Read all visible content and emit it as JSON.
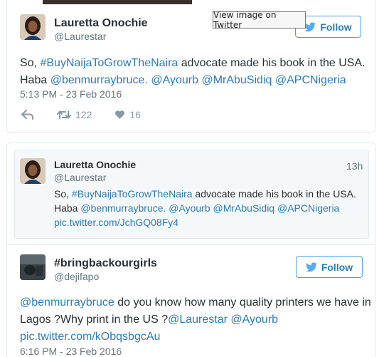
{
  "tooltip": "View image on Twitter",
  "tweet1": {
    "name": "Lauretta Onochie",
    "handle": "@Laurestar",
    "follow_label": "Follow",
    "text_line1_prefix": "So, ",
    "text_line1_hashtag": "#BuyNaijaToGrowTheNaira",
    "text_line1_suffix": " advocate made his book in the USA.",
    "text_line2_prefix": "Haba ",
    "mention1": "@benmurraybruce.",
    "mention2": "@Ayourb",
    "mention3": "@MrAbuSidiq",
    "mention4": "@APCNigeria",
    "timestamp": "5:13 PM - 23 Feb 2016",
    "retweets": "122",
    "likes": "16"
  },
  "quoted": {
    "name": "Lauretta Onochie",
    "handle": "@Laurestar",
    "time": "13h",
    "text_line1_prefix": "So, ",
    "text_line1_hashtag": "#BuyNaijaToGrowTheNaira",
    "text_line1_suffix": " advocate made his book in the USA.",
    "text_line2_prefix": "Haba ",
    "mention1": "@benmurraybruce.",
    "mention2": "@Ayourb",
    "mention3": "@MrAbuSidiq",
    "mention4": "@APCNigeria",
    "pic_link": "pic.twitter.com/JchGQ08Fy4"
  },
  "tweet2": {
    "name": "#bringbackourgirls",
    "handle": "@dejifapo",
    "follow_label": "Follow",
    "mention_ben": "@benmurraybruce",
    "text_line1_suffix": " do you know how many quality printers we have in",
    "text_line2_prefix": "Lagos ?Why print in the US ?",
    "mention_lauretta": "@Laurestar",
    "mention_ayourb": "@Ayourb",
    "pic_link": "pic.twitter.com/kObqsbgcAu",
    "timestamp": "6:16 PM - 23 Feb 2016"
  }
}
